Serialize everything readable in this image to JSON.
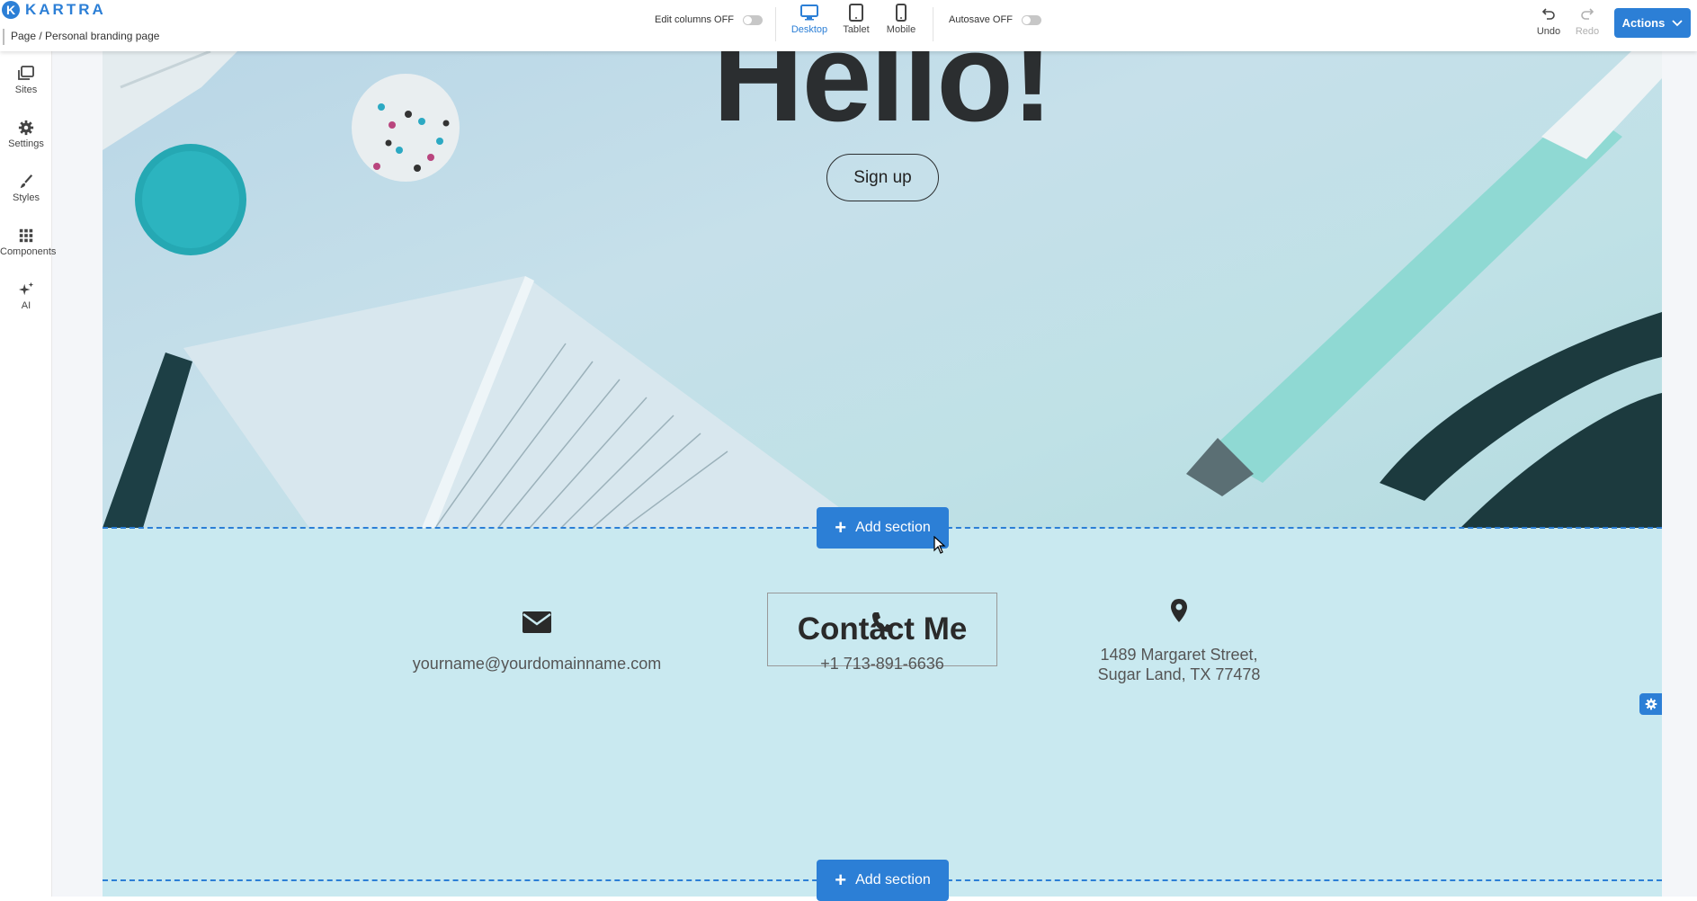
{
  "app": {
    "logo_letter": "K",
    "logo_word": "KARTRA",
    "brand_color": "#2c7fd6"
  },
  "breadcrumb": "Page / Personal branding page",
  "toolbar": {
    "edit_columns_label": "Edit columns OFF",
    "autosave_label": "Autosave OFF",
    "devices": [
      {
        "label": "Desktop",
        "icon": "desktop-icon",
        "active": true
      },
      {
        "label": "Tablet",
        "icon": "tablet-icon",
        "active": false
      },
      {
        "label": "Mobile",
        "icon": "mobile-icon",
        "active": false
      }
    ],
    "undo_label": "Undo",
    "redo_label": "Redo",
    "actions_label": "Actions"
  },
  "sidebar": {
    "items": [
      {
        "label": "Sites",
        "icon": "pages-icon"
      },
      {
        "label": "Settings",
        "icon": "gear-icon"
      },
      {
        "label": "Styles",
        "icon": "brush-icon"
      },
      {
        "label": "Components",
        "icon": "grid-icon"
      },
      {
        "label": "AI",
        "icon": "sparkle-icon"
      }
    ]
  },
  "hero": {
    "title": "Hello!",
    "button_label": "Sign up"
  },
  "add_section_label": "Add section",
  "contact": {
    "title": "Contact Me",
    "email": "yourname@yourdomainname.com",
    "phone": "+1 713-891-6636",
    "address_line1": "1489 Margaret Street,",
    "address_line2": "Sugar Land, TX 77478"
  }
}
